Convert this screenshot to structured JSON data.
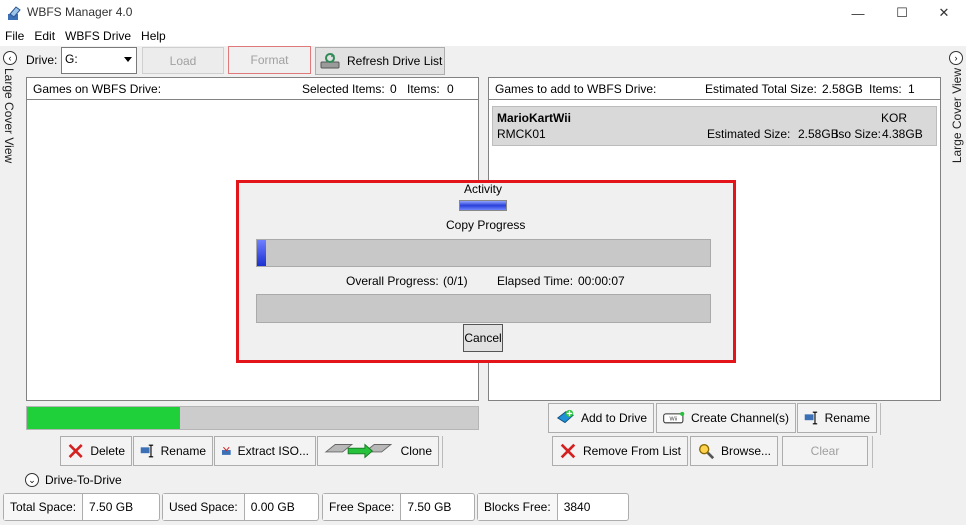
{
  "window": {
    "title": "WBFS Manager 4.0",
    "minimize": "—",
    "maximize": "☐",
    "close": "✕"
  },
  "menu": [
    "File",
    "Edit",
    "WBFS Drive",
    "Help"
  ],
  "left_side": {
    "label": "Large Cover View",
    "arrow": "‹"
  },
  "right_side": {
    "label": "Large Cover View",
    "arrow": "›"
  },
  "toolbar": {
    "drive_label": "Drive:",
    "drive_value": "G:",
    "load": "Load",
    "format": "Format",
    "refresh": "Refresh Drive List"
  },
  "left_panel": {
    "header": "Games on WBFS Drive:",
    "selected_label": "Selected Items:",
    "selected_value": "0",
    "items_label": "Items:",
    "items_value": "0"
  },
  "right_panel": {
    "header": "Games to add to WBFS Drive:",
    "est_total_label": "Estimated Total Size:",
    "est_total_value": "2.58GB",
    "items_label": "Items:",
    "items_value": "1",
    "game": {
      "title": "MarioKartWii",
      "id": "RMCK01",
      "region": "KOR",
      "est_size_label": "Estimated Size:",
      "est_size_value": "2.58GB",
      "iso_size_label": "Iso Size:",
      "iso_size_value": "4.38GB"
    }
  },
  "progress_dialog": {
    "activity": "Activity",
    "copy_progress": "Copy Progress",
    "overall_label": "Overall Progress:",
    "overall_value": "(0/1)",
    "elapsed_label": "Elapsed Time:",
    "elapsed_value": "00:00:07",
    "cancel": "Cancel",
    "copy_fraction": 0.02,
    "overall_fraction": 0.0
  },
  "drive_usage_fraction": 0.34,
  "left_actions": {
    "delete": "Delete",
    "rename": "Rename",
    "extract": "Extract ISO...",
    "clone": "Clone"
  },
  "right_actions": {
    "add": "Add to Drive",
    "create_channel": "Create Channel(s)",
    "rename": "Rename",
    "remove": "Remove From List",
    "browse": "Browse...",
    "clear": "Clear"
  },
  "drive_to_drive": {
    "label": "Drive-To-Drive",
    "arrow": "⌄"
  },
  "status": {
    "total_label": "Total Space:",
    "total_value": "7.50 GB",
    "used_label": "Used Space:",
    "used_value": "0.00 GB",
    "free_label": "Free Space:",
    "free_value": "7.50 GB",
    "blocks_label": "Blocks Free:",
    "blocks_value": "3840"
  },
  "colors": {
    "highlight": "#e4141b",
    "usage_bar": "#1fd03a",
    "progress_blue": "#2a3fd8"
  }
}
